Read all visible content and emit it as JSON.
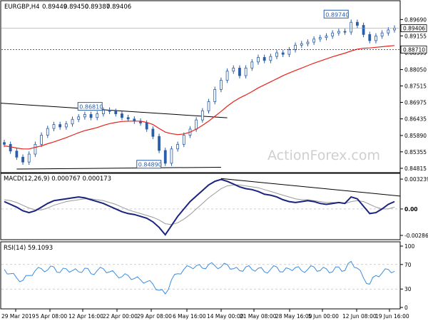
{
  "chart_data": [
    {
      "panel": "price",
      "type": "candlestick",
      "header": {
        "symbol": "EURGBP,H4",
        "open": "0.89449",
        "high": "0.89450",
        "low": "0.89387",
        "close": "0.89406"
      },
      "y_ticks": [
        "0.89690",
        "0.89155",
        "0.88595",
        "0.88050",
        "0.87515",
        "0.86975",
        "0.86435",
        "0.85890",
        "0.85355",
        "0.84815"
      ],
      "ylim": [
        0.8472,
        0.8998
      ],
      "last_price_label": "0.89406",
      "ma_end_label": "0.88710",
      "annotations": [
        "0.89740",
        "0.86810",
        "0.84890"
      ],
      "watermark": "ActionForex.com",
      "close_series": [
        0.856,
        0.8538,
        0.8518,
        0.8502,
        0.8528,
        0.856,
        0.859,
        0.8612,
        0.8625,
        0.8617,
        0.8627,
        0.8642,
        0.865,
        0.8658,
        0.8648,
        0.866,
        0.8672,
        0.8668,
        0.866,
        0.8648,
        0.8643,
        0.8636,
        0.863,
        0.861,
        0.8586,
        0.854,
        0.8498,
        0.8545,
        0.856,
        0.859,
        0.861,
        0.864,
        0.867,
        0.87,
        0.874,
        0.877,
        0.88,
        0.881,
        0.8785,
        0.881,
        0.883,
        0.8845,
        0.8835,
        0.8848,
        0.886,
        0.8855,
        0.887,
        0.8885,
        0.889,
        0.8895,
        0.8905,
        0.891,
        0.8915,
        0.8925,
        0.893,
        0.8928,
        0.896,
        0.895,
        0.892,
        0.89,
        0.8915,
        0.8925,
        0.8935,
        0.8941
      ],
      "ma_series": [
        0.8555,
        0.8552,
        0.8548,
        0.8545,
        0.8545,
        0.855,
        0.8555,
        0.8562,
        0.8568,
        0.8575,
        0.8582,
        0.859,
        0.8598,
        0.8605,
        0.861,
        0.8615,
        0.8622,
        0.8628,
        0.8632,
        0.8635,
        0.8636,
        0.8636,
        0.8636,
        0.8632,
        0.8625,
        0.8612,
        0.86,
        0.8595,
        0.8592,
        0.8594,
        0.86,
        0.861,
        0.8622,
        0.8636,
        0.8652,
        0.8668,
        0.8685,
        0.87,
        0.8712,
        0.8722,
        0.8733,
        0.8745,
        0.8755,
        0.8765,
        0.8775,
        0.8785,
        0.8794,
        0.8802,
        0.881,
        0.8818,
        0.8826,
        0.8833,
        0.884,
        0.8847,
        0.8853,
        0.8859,
        0.8866,
        0.8872,
        0.8875,
        0.8876,
        0.8878,
        0.888,
        0.8882,
        0.8884
      ]
    },
    {
      "panel": "macd",
      "type": "line",
      "header": "MACD(12,26,9) 0.000767 0.000173",
      "y_ticks": [
        "0.003239",
        "0.00",
        "-0.002868"
      ],
      "ylim": [
        -0.0031,
        0.0034
      ],
      "zero_label": "0.00",
      "macd_series": [
        0.0008,
        0.0005,
        0.0002,
        -0.0002,
        -0.0004,
        -0.0002,
        0.0002,
        0.0006,
        0.0009,
        0.001,
        0.0011,
        0.0012,
        0.0013,
        0.0012,
        0.001,
        0.0008,
        0.0006,
        0.0003,
        0.0,
        -0.0003,
        -0.0005,
        -0.0006,
        -0.0008,
        -0.001,
        -0.0014,
        -0.002,
        -0.0028,
        -0.0018,
        -0.0008,
        0.0,
        0.0008,
        0.0014,
        0.002,
        0.0026,
        0.003,
        0.0032,
        0.003,
        0.0027,
        0.0024,
        0.0022,
        0.0021,
        0.0019,
        0.0016,
        0.0015,
        0.0013,
        0.001,
        0.0008,
        0.0007,
        0.0008,
        0.0009,
        0.0008,
        0.0006,
        0.0005,
        0.0006,
        0.0007,
        0.0006,
        0.0013,
        0.0011,
        0.0003,
        -0.0005,
        -0.0004,
        0.0,
        0.0005,
        0.0008
      ],
      "signal_series": [
        0.001,
        0.0009,
        0.0007,
        0.0004,
        0.0001,
        -0.0001,
        -0.0001,
        0.0001,
        0.0004,
        0.0006,
        0.0008,
        0.0009,
        0.001,
        0.0011,
        0.0011,
        0.001,
        0.0009,
        0.0007,
        0.0005,
        0.0002,
        -0.0001,
        -0.0003,
        -0.0005,
        -0.0007,
        -0.0009,
        -0.0012,
        -0.0016,
        -0.0017,
        -0.0015,
        -0.0011,
        -0.0006,
        0.0,
        0.0006,
        0.0012,
        0.0017,
        0.0022,
        0.0025,
        0.0026,
        0.0026,
        0.0025,
        0.0024,
        0.0023,
        0.0021,
        0.0019,
        0.0017,
        0.0015,
        0.0013,
        0.0011,
        0.001,
        0.001,
        0.0009,
        0.0008,
        0.0007,
        0.0007,
        0.0007,
        0.0006,
        0.0008,
        0.0009,
        0.0008,
        0.0005,
        0.0002,
        0.0,
        0.0,
        0.0002
      ],
      "trendline": [
        0.0033,
        0.0014
      ]
    },
    {
      "panel": "rsi",
      "type": "line",
      "header": "RSI(14) 59.1093",
      "y_ticks": [
        "100",
        "70",
        "30",
        "0"
      ],
      "ylim": [
        0,
        100
      ],
      "levels": [
        70,
        30
      ],
      "rsi_series": [
        62,
        55,
        48,
        44,
        52,
        60,
        63,
        61,
        66,
        57,
        63,
        60,
        58,
        64,
        55,
        60,
        63,
        58,
        54,
        50,
        52,
        47,
        45,
        42,
        38,
        28,
        22,
        45,
        55,
        62,
        66,
        68,
        64,
        70,
        68,
        66,
        70,
        63,
        60,
        66,
        62,
        64,
        58,
        62,
        66,
        58,
        63,
        65,
        60,
        62,
        66,
        60,
        63,
        58,
        66,
        60,
        75,
        64,
        48,
        38,
        52,
        56,
        62,
        59
      ]
    }
  ],
  "x_axis": {
    "labels": [
      "29 Mar 2019",
      "5 Apr 08:00",
      "12 Apr 16:00",
      "22 Apr 00:00",
      "29 Apr 08:00",
      "6 May 16:00",
      "14 May 00:00",
      "21 May 08:00",
      "28 May 16:00",
      "5 Jun 00:00",
      "12 Jun 08:00",
      "19 Jun 16:00"
    ]
  }
}
